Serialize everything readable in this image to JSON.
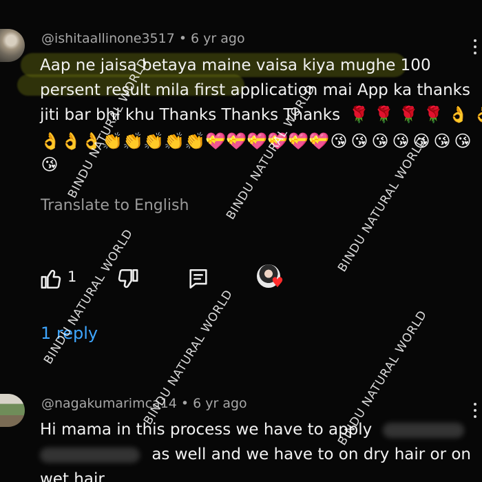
{
  "comments": [
    {
      "author": "@ishitaallinone3517",
      "age": "6 yr ago",
      "lines": [
        "Aap ne jaisa betaya maine vaisa kiya mughe  100",
        "persent result mila first application mai App ka  thanks",
        "jiti bar bhi khu Thanks Thanks Thanks"
      ],
      "emoji_line_1_suffix": [
        "🌹",
        "🌹",
        "🌹",
        "🌹",
        "👌",
        "👌"
      ],
      "emoji_line_2": [
        "👌",
        "👌",
        "👌",
        "👏",
        "👏",
        "👏",
        "👏",
        "👏",
        "💝",
        "💝",
        "💝",
        "💝",
        "💝",
        "💝",
        "😘",
        "😘",
        "😘",
        "😘",
        "😘",
        "😘",
        "😘"
      ],
      "emoji_line_3": [
        "😘"
      ],
      "translate_label": "Translate to English",
      "likes": "1",
      "reply_label": "1 reply"
    },
    {
      "author": "@nagakumarimca14",
      "age": "6 yr ago",
      "line1_prefix": "Hi mama in this process we have to apply",
      "line2_suffix": "as well and we have to on dry hair or on",
      "line3": "wet hair"
    }
  ],
  "watermark": "BINDU NATURAL WORLD",
  "colors": {
    "background": "#070707",
    "meta": "#a7a7a7",
    "link": "#3ea6ff",
    "highlight": "#7b8310"
  },
  "icons": {
    "like": "thumb-up-icon",
    "dislike": "thumb-down-icon",
    "reply": "comment-icon",
    "more": "more-vertical-icon",
    "heart": "heart-icon"
  }
}
